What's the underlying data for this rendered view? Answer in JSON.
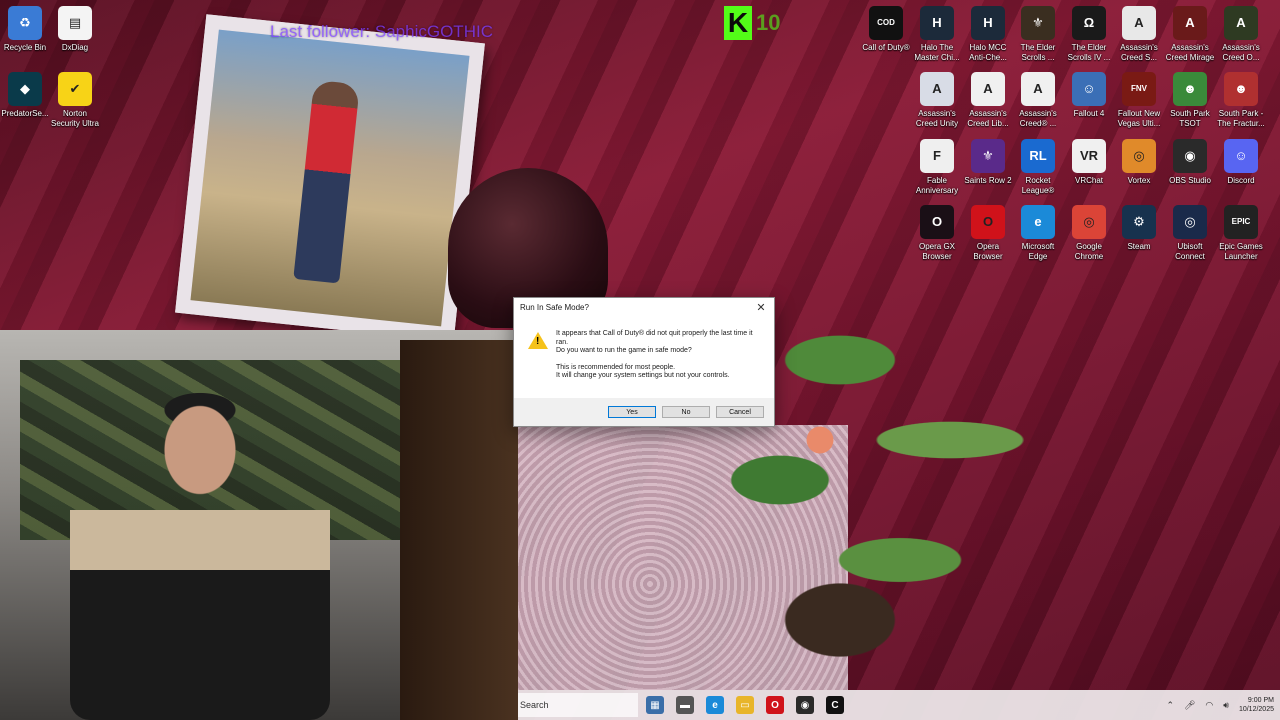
{
  "overlay": {
    "stream_title": "Last follower: SaphicGOTHIC"
  },
  "desktop_icons_left": [
    {
      "label": "Recycle Bin",
      "icon": "recycle-bin-icon",
      "color": "#3a7bd5",
      "glyph": "♻"
    },
    {
      "label": "DxDiag",
      "icon": "document-icon",
      "color": "#f4f4f4",
      "glyph": "▤"
    },
    {
      "label": "PredatorSe...",
      "icon": "predator-icon",
      "color": "#0a3a4a",
      "glyph": "◆"
    },
    {
      "label": "Norton Security Ultra",
      "icon": "norton-icon",
      "color": "#f7d317",
      "glyph": "✔"
    }
  ],
  "desktop_icons_right": [
    {
      "label": "Call of Duty®",
      "icon": "call-of-duty-icon",
      "color": "#111111",
      "glyph": "COD"
    },
    {
      "label": "Halo The Master Chi...",
      "icon": "halo-icon",
      "color": "#1c2a3a",
      "glyph": "H"
    },
    {
      "label": "Halo MCC Anti-Che...",
      "icon": "halo-mcc-icon",
      "color": "#1c2a3a",
      "glyph": "H"
    },
    {
      "label": "The Elder Scrolls ...",
      "icon": "elder-scrolls-icon",
      "color": "#3a2e20",
      "glyph": "⚜"
    },
    {
      "label": "The Elder Scrolls IV ...",
      "icon": "oblivion-icon",
      "color": "#1a1a1a",
      "glyph": "Ω"
    },
    {
      "label": "Assassin's Creed S...",
      "icon": "assassins-creed-icon",
      "color": "#e8e8e8",
      "glyph": "A"
    },
    {
      "label": "Assassin's Creed Mirage",
      "icon": "assassins-creed-mirage-icon",
      "color": "#6a1a1a",
      "glyph": "A"
    },
    {
      "label": "Assassin's Creed O...",
      "icon": "assassins-creed-origins-icon",
      "color": "#2e3a22",
      "glyph": "A"
    },
    {
      "label": "Assassin's Creed Unity",
      "icon": "assassins-creed-unity-icon",
      "color": "#d8dce6",
      "glyph": "A"
    },
    {
      "label": "Assassin's Creed Lib...",
      "icon": "assassins-creed-liberation-icon",
      "color": "#f0f0f0",
      "glyph": "A"
    },
    {
      "label": "Assassin's Creed® ...",
      "icon": "assassins-creed-3-icon",
      "color": "#f0f0f0",
      "glyph": "A"
    },
    {
      "label": "Fallout 4",
      "icon": "fallout-4-icon",
      "color": "#3b6fb6",
      "glyph": "☺"
    },
    {
      "label": "Fallout New Vegas Ulti...",
      "icon": "fallout-new-vegas-icon",
      "color": "#7a1a14",
      "glyph": "FNV"
    },
    {
      "label": "South Park TSOT",
      "icon": "south-park-tsot-icon",
      "color": "#3a8a3a",
      "glyph": "☻"
    },
    {
      "label": "South Park - The Fractur...",
      "icon": "south-park-fbw-icon",
      "color": "#b03030",
      "glyph": "☻"
    },
    {
      "label": "Fable Anniversary",
      "icon": "fable-icon",
      "color": "#efefef",
      "glyph": "F"
    },
    {
      "label": "Saints Row 2",
      "icon": "saints-row-icon",
      "color": "#5a2a8a",
      "glyph": "⚜"
    },
    {
      "label": "Rocket League®",
      "icon": "rocket-league-icon",
      "color": "#1a6ad0",
      "glyph": "RL"
    },
    {
      "label": "VRChat",
      "icon": "vrchat-icon",
      "color": "#f0f0f0",
      "glyph": "VR"
    },
    {
      "label": "Vortex",
      "icon": "vortex-icon",
      "color": "#e08a2a",
      "glyph": "◎"
    },
    {
      "label": "OBS Studio",
      "icon": "obs-icon",
      "color": "#2a2a2a",
      "glyph": "◉"
    },
    {
      "label": "Discord",
      "icon": "discord-icon",
      "color": "#5865f2",
      "glyph": "☺"
    },
    {
      "label": "Opera GX Browser",
      "icon": "opera-gx-icon",
      "color": "#1a0f16",
      "glyph": "O"
    },
    {
      "label": "Opera Browser",
      "icon": "opera-icon",
      "color": "#d0121a",
      "glyph": "O"
    },
    {
      "label": "Microsoft Edge",
      "icon": "edge-icon",
      "color": "#1b8ad8",
      "glyph": "e"
    },
    {
      "label": "Google Chrome",
      "icon": "chrome-icon",
      "color": "#db4437",
      "glyph": "◎"
    },
    {
      "label": "Steam",
      "icon": "steam-icon",
      "color": "#17324e",
      "glyph": "⚙"
    },
    {
      "label": "Ubisoft Connect",
      "icon": "ubisoft-icon",
      "color": "#1a2a4a",
      "glyph": "◎"
    },
    {
      "label": "Epic Games Launcher",
      "icon": "epic-games-icon",
      "color": "#222222",
      "glyph": "EPIC"
    }
  ],
  "dialog": {
    "title": "Run In Safe Mode?",
    "line1": "It appears that Call of Duty® did not quit properly the last time it ran.",
    "line2": "Do you want to run the game in safe mode?",
    "line3": "This is recommended for most people.",
    "line4": "It will change your system settings but not your controls.",
    "yes_label": "Yes",
    "no_label": "No",
    "cancel_label": "Cancel",
    "close_glyph": "✕"
  },
  "taskbar": {
    "search_placeholder": "Search",
    "time": "9:00 PM",
    "date": "10/12/2025"
  }
}
